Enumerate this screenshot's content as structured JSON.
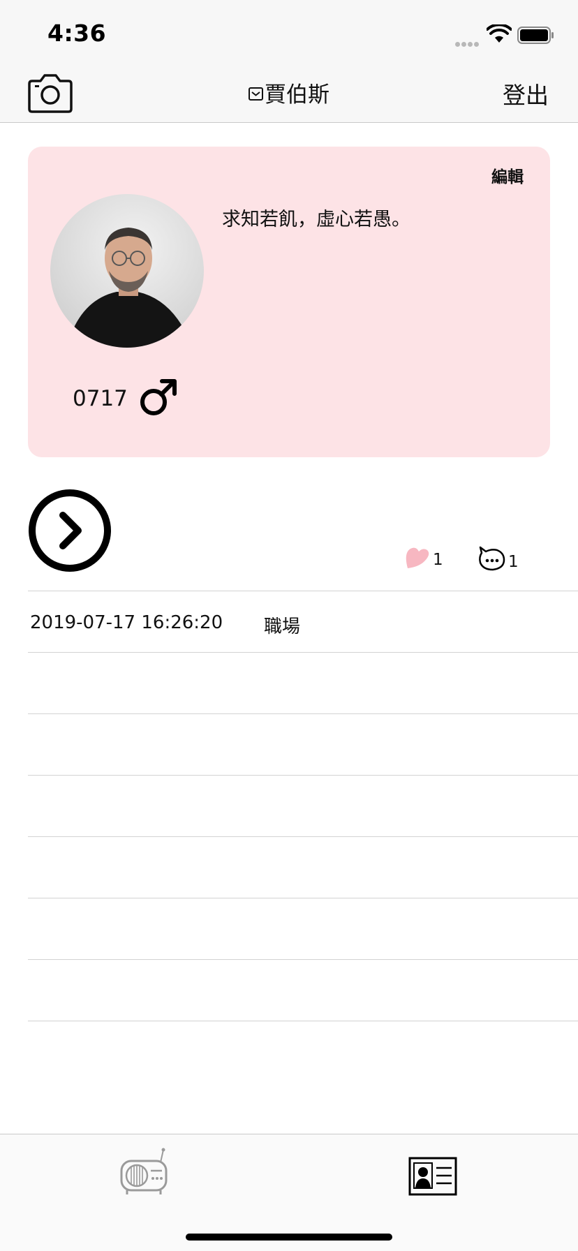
{
  "status_bar": {
    "time": "4:36"
  },
  "nav": {
    "title": "賈伯斯",
    "logout_label": "登出"
  },
  "profile": {
    "edit_label": "編輯",
    "motto": "求知若飢，虛心若愚。",
    "birthday": "0717",
    "gender_icon": "male-symbol"
  },
  "post": {
    "like_count": "1",
    "comment_count": "1"
  },
  "list": {
    "rows": [
      {
        "date": "2019-07-17 16:26:20",
        "category": "職場"
      },
      {
        "date": "",
        "category": ""
      },
      {
        "date": "",
        "category": ""
      },
      {
        "date": "",
        "category": ""
      },
      {
        "date": "",
        "category": ""
      },
      {
        "date": "",
        "category": ""
      },
      {
        "date": "",
        "category": ""
      },
      {
        "date": "",
        "category": ""
      }
    ]
  },
  "tab_bar": {
    "tabs": [
      "radio-icon",
      "profile-card-icon"
    ],
    "selected": "profile-card-icon"
  },
  "colors": {
    "card_bg": "#fde3e6",
    "like_pink": "#f7b7c1"
  }
}
